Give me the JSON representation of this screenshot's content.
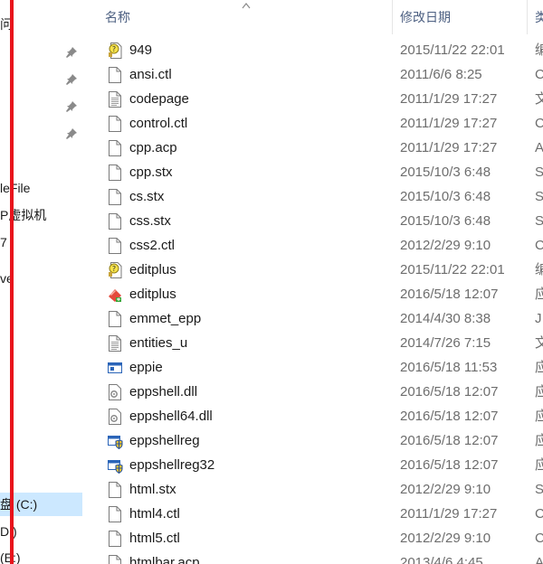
{
  "nav": {
    "items": [
      {
        "label": "问",
        "selected": false
      },
      {
        "label": "leFile",
        "selected": false
      },
      {
        "label": "P虚拟机",
        "selected": false
      },
      {
        "label": "7",
        "selected": false
      },
      {
        "label": "ve",
        "selected": false
      },
      {
        "label": "盘 (C:)",
        "selected": true
      },
      {
        "label": "D:)",
        "selected": false
      },
      {
        "label": "(E:)",
        "selected": false
      }
    ],
    "pin_icon": "pin-icon"
  },
  "header": {
    "name_col": "名称",
    "date_col": "修改日期",
    "type_col": "类"
  },
  "files": [
    {
      "name": "949",
      "date": "2015/11/22 22:01",
      "type": "编",
      "icon": "help-file-icon"
    },
    {
      "name": "ansi.ctl",
      "date": "2011/6/6 8:25",
      "type": "C",
      "icon": "blank-file-icon"
    },
    {
      "name": "codepage",
      "date": "2011/1/29 17:27",
      "type": "文",
      "icon": "text-file-icon"
    },
    {
      "name": "control.ctl",
      "date": "2011/1/29 17:27",
      "type": "C",
      "icon": "blank-file-icon"
    },
    {
      "name": "cpp.acp",
      "date": "2011/1/29 17:27",
      "type": "A",
      "icon": "blank-file-icon"
    },
    {
      "name": "cpp.stx",
      "date": "2015/10/3 6:48",
      "type": "S",
      "icon": "blank-file-icon"
    },
    {
      "name": "cs.stx",
      "date": "2015/10/3 6:48",
      "type": "S",
      "icon": "blank-file-icon"
    },
    {
      "name": "css.stx",
      "date": "2015/10/3 6:48",
      "type": "S",
      "icon": "blank-file-icon"
    },
    {
      "name": "css2.ctl",
      "date": "2012/2/29 9:10",
      "type": "C",
      "icon": "blank-file-icon"
    },
    {
      "name": "editplus",
      "date": "2015/11/22 22:01",
      "type": "编",
      "icon": "help-file-icon"
    },
    {
      "name": "editplus",
      "date": "2016/5/18 12:07",
      "type": "应",
      "icon": "editplus-app-icon"
    },
    {
      "name": "emmet_epp",
      "date": "2014/4/30 8:38",
      "type": "J",
      "icon": "blank-file-icon"
    },
    {
      "name": "entities_u",
      "date": "2014/7/26 7:15",
      "type": "文",
      "icon": "text-file-icon"
    },
    {
      "name": "eppie",
      "date": "2016/5/18 11:53",
      "type": "应",
      "icon": "app-window-icon"
    },
    {
      "name": "eppshell.dll",
      "date": "2016/5/18 12:07",
      "type": "应",
      "icon": "dll-file-icon"
    },
    {
      "name": "eppshell64.dll",
      "date": "2016/5/18 12:07",
      "type": "应",
      "icon": "dll-file-icon"
    },
    {
      "name": "eppshellreg",
      "date": "2016/5/18 12:07",
      "type": "应",
      "icon": "shield-app-icon"
    },
    {
      "name": "eppshellreg32",
      "date": "2016/5/18 12:07",
      "type": "应",
      "icon": "shield-app-icon"
    },
    {
      "name": "html.stx",
      "date": "2012/2/29 9:10",
      "type": "S",
      "icon": "blank-file-icon"
    },
    {
      "name": "html4.ctl",
      "date": "2011/1/29 17:27",
      "type": "C",
      "icon": "blank-file-icon"
    },
    {
      "name": "html5.ctl",
      "date": "2012/2/29 9:10",
      "type": "C",
      "icon": "blank-file-icon"
    },
    {
      "name": "htmlbar.acp",
      "date": "2013/4/6 4:45",
      "type": "A",
      "icon": "blank-file-icon"
    }
  ]
}
